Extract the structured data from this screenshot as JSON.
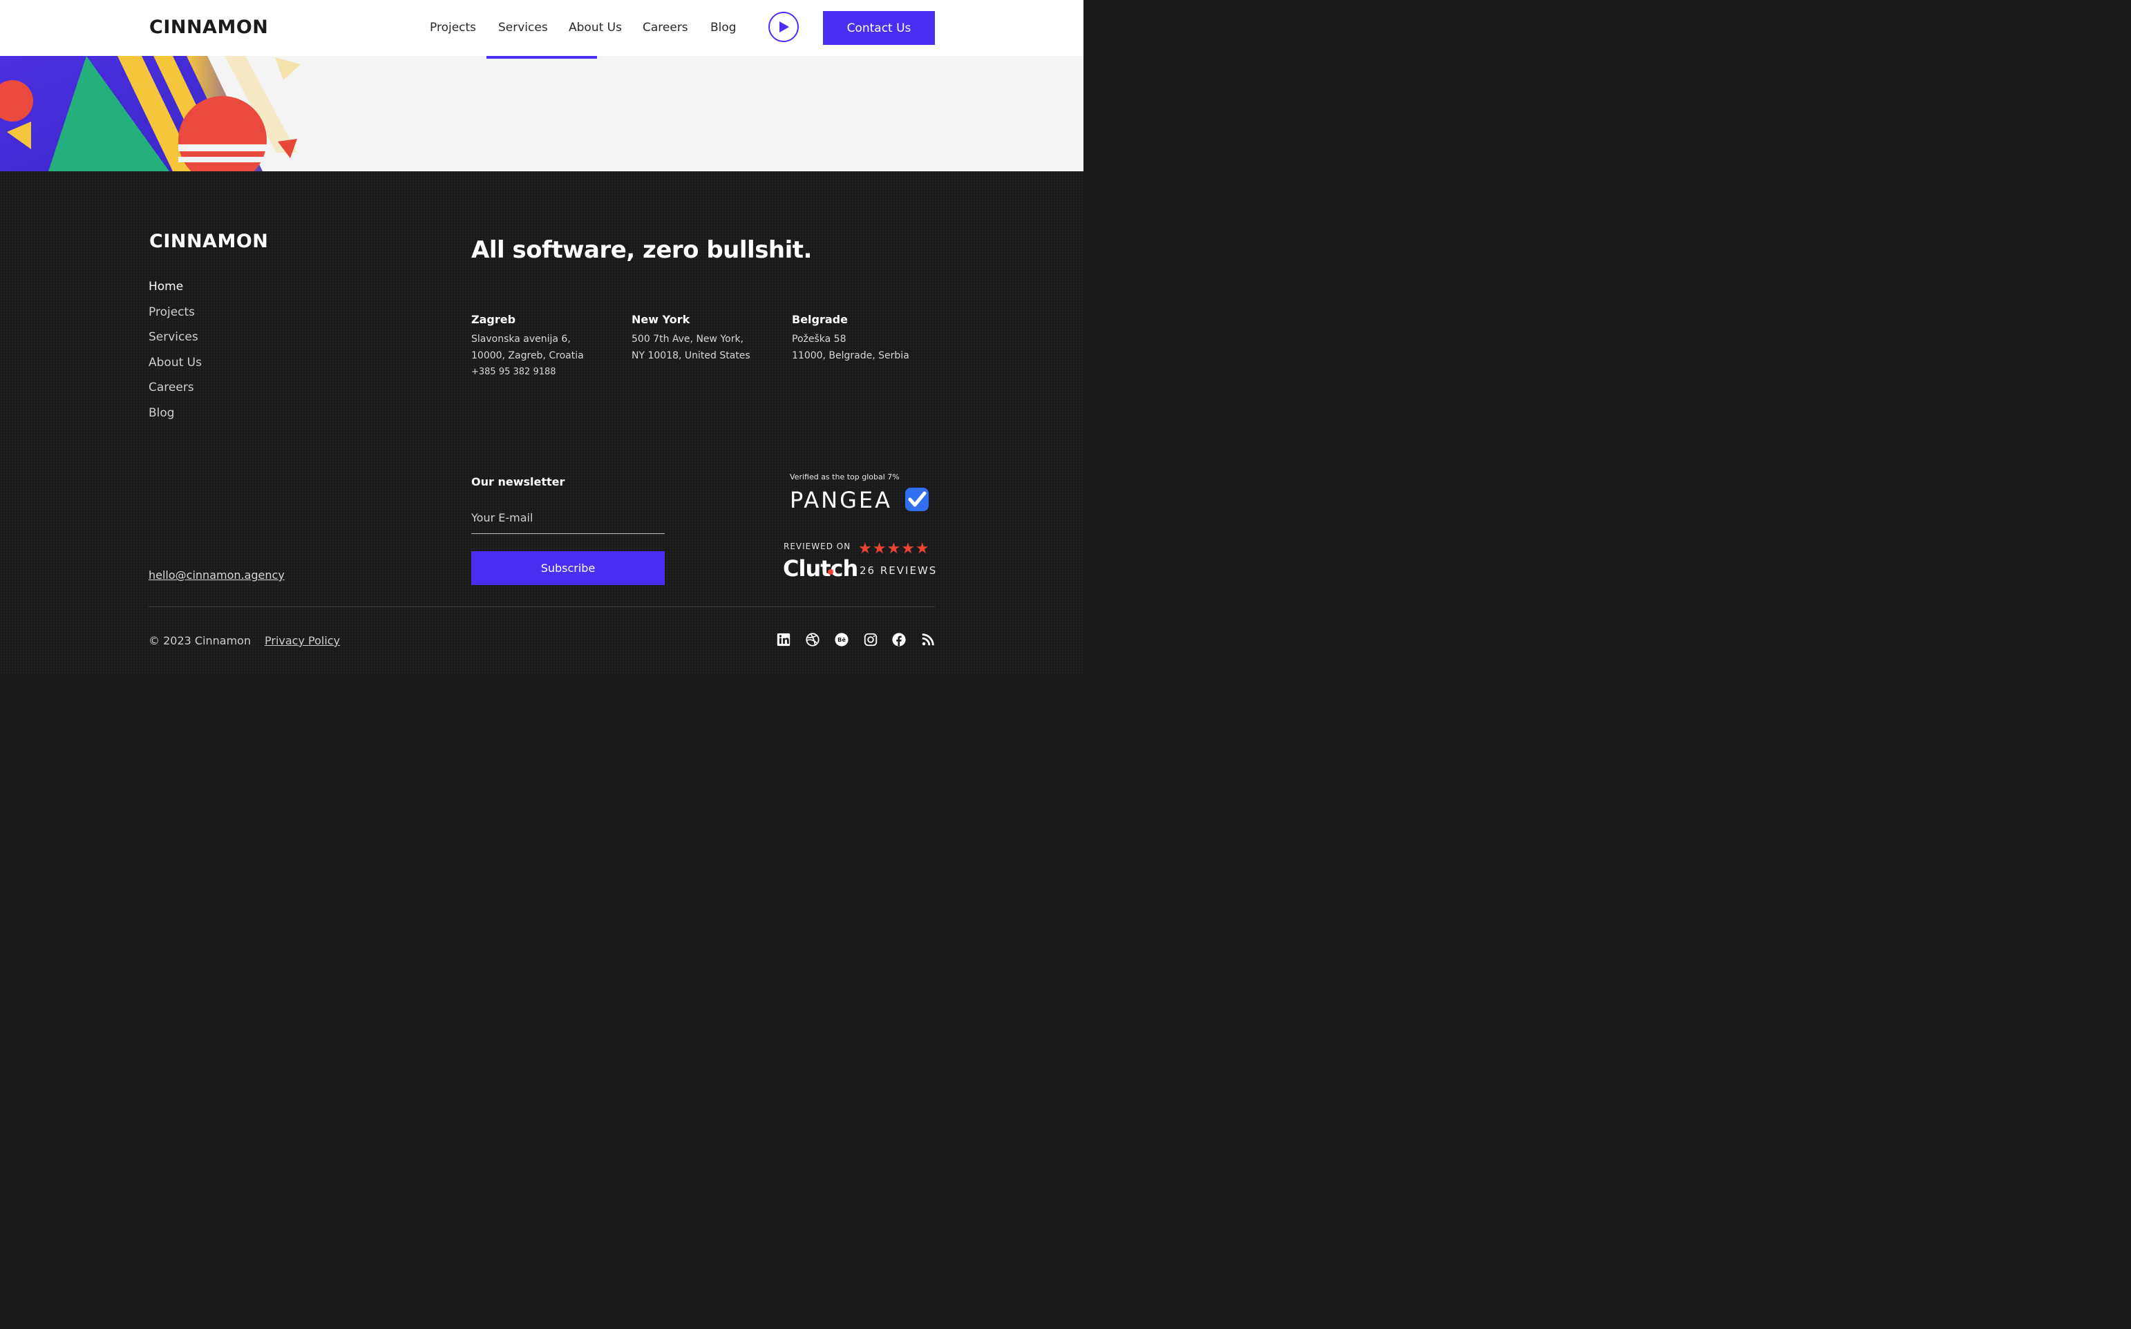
{
  "header": {
    "logo": "CINNAMON",
    "nav": [
      "Projects",
      "Services",
      "About Us",
      "Careers",
      "Blog"
    ],
    "contact_label": "Contact Us"
  },
  "footer": {
    "logo": "CINNAMON",
    "links": [
      "Home",
      "Projects",
      "Services",
      "About Us",
      "Careers",
      "Blog"
    ],
    "tagline": "All software, zero bullshit.",
    "offices": [
      {
        "city": "Zagreb",
        "lines": [
          "Slavonska avenija 6,",
          "10000, Zagreb, Croatia",
          "+385 95 382 9188"
        ]
      },
      {
        "city": "New York",
        "lines": [
          "500 7th Ave, New York,",
          "NY 10018, United States"
        ]
      },
      {
        "city": "Belgrade",
        "lines": [
          "Požeška 58",
          "11000, Belgrade, Serbia"
        ]
      }
    ],
    "newsletter": {
      "title": "Our newsletter",
      "placeholder": "Your E-mail",
      "button": "Subscribe"
    },
    "email": "hello@cinnamon.agency",
    "pangea": {
      "caption": "Verified as the top global 7%",
      "name": "PANGEA"
    },
    "clutch": {
      "caption": "REVIEWED ON",
      "name": "Clutch",
      "reviews": "26 REVIEWS",
      "stars": "★★★★★",
      "rating": 5
    },
    "copyright": "© 2023 Cinnamon",
    "privacy": "Privacy Policy",
    "social": [
      "linkedin-icon",
      "dribbble-icon",
      "behance-icon",
      "instagram-icon",
      "facebook-icon",
      "rss-icon"
    ]
  },
  "colors": {
    "accent": "#4a2ef2",
    "footer_bg": "#1a1a1a",
    "star": "#ef4335"
  }
}
